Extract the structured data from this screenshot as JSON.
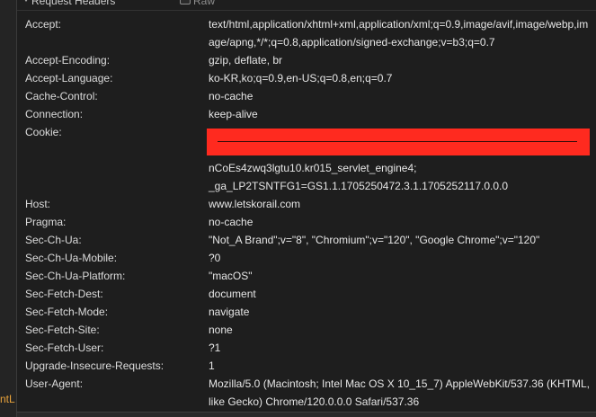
{
  "section": {
    "title": "Request Headers",
    "raw_label": "Raw"
  },
  "left_strip": {
    "cut_label": "ntL"
  },
  "headers": [
    {
      "name": "Accept:",
      "value": "text/html,application/xhtml+xml,application/xml;q=0.9,image/avif,image/webp,image/apng,*/*;q=0.8,application/signed-exchange;v=b3;q=0.7"
    },
    {
      "name": "Accept-Encoding:",
      "value": "gzip, deflate, br"
    },
    {
      "name": "Accept-Language:",
      "value": "ko-KR,ko;q=0.9,en-US;q=0.8,en;q=0.7"
    },
    {
      "name": "Cache-Control:",
      "value": "no-cache"
    },
    {
      "name": "Connection:",
      "value": "keep-alive"
    },
    {
      "name": "Cookie:",
      "value_line1": "nCoEs4zwq3lgtu10.kr015_servlet_engine4;",
      "value_line2": "_ga_LP2TSNTFG1=GS1.1.1705250472.3.1.1705252117.0.0.0"
    },
    {
      "name": "Host:",
      "value": "www.letskorail.com"
    },
    {
      "name": "Pragma:",
      "value": "no-cache"
    },
    {
      "name": "Sec-Ch-Ua:",
      "value": "\"Not_A Brand\";v=\"8\", \"Chromium\";v=\"120\", \"Google Chrome\";v=\"120\""
    },
    {
      "name": "Sec-Ch-Ua-Mobile:",
      "value": "?0"
    },
    {
      "name": "Sec-Ch-Ua-Platform:",
      "value": "\"macOS\""
    },
    {
      "name": "Sec-Fetch-Dest:",
      "value": "document"
    },
    {
      "name": "Sec-Fetch-Mode:",
      "value": "navigate"
    },
    {
      "name": "Sec-Fetch-Site:",
      "value": "none"
    },
    {
      "name": "Sec-Fetch-User:",
      "value": "?1"
    },
    {
      "name": "Upgrade-Insecure-Requests:",
      "value": "1"
    },
    {
      "name": "User-Agent:",
      "value": "Mozilla/5.0 (Macintosh; Intel Mac OS X 10_15_7) AppleWebKit/537.36 (KHTML, like Gecko) Chrome/120.0.0.0 Safari/537.36"
    }
  ],
  "colors": {
    "background": "#1e1e1e",
    "text": "#e2e2e2",
    "redaction": "#ff2a1f",
    "accent_cut_label": "#e8a23a"
  }
}
